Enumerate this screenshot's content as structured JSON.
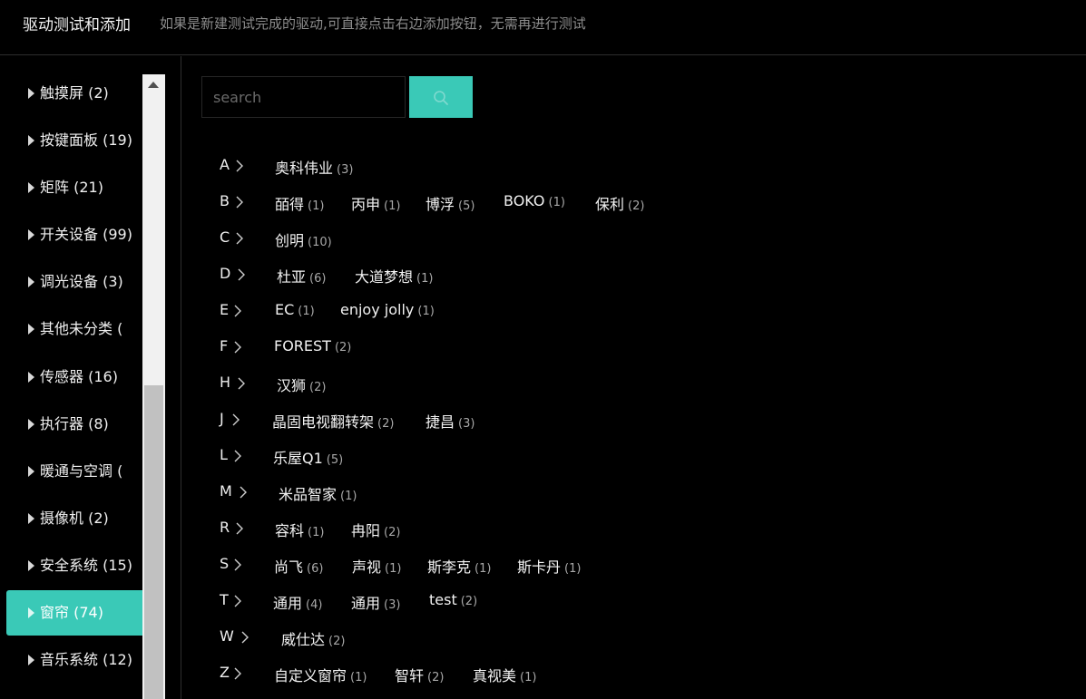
{
  "header": {
    "title": "驱动测试和添加",
    "hint": "如果是新建测试完成的驱动,可直接点击右边添加按钮，无需再进行测试"
  },
  "sidebar": {
    "items": [
      {
        "label": "触摸屏 (2)",
        "active": false
      },
      {
        "label": "按键面板 (19)",
        "active": false
      },
      {
        "label": "矩阵 (21)",
        "active": false
      },
      {
        "label": "开关设备 (99)",
        "active": false
      },
      {
        "label": "调光设备 (3)",
        "active": false
      },
      {
        "label": "其他未分类 (",
        "active": false
      },
      {
        "label": "传感器 (16)",
        "active": false
      },
      {
        "label": "执行器 (8)",
        "active": false
      },
      {
        "label": "暖通与空调 (",
        "active": false
      },
      {
        "label": "摄像机 (2)",
        "active": false
      },
      {
        "label": "安全系统 (15)",
        "active": false
      },
      {
        "label": "窗帘 (74)",
        "active": true
      },
      {
        "label": "音乐系统 (12)",
        "active": false
      }
    ]
  },
  "search": {
    "placeholder": "search",
    "value": "",
    "button_icon": "search-icon"
  },
  "colors": {
    "accent": "#3ac9b7",
    "background": "#000000",
    "text": "#f0f0f0",
    "muted": "#a8a8a8"
  },
  "brand_groups": [
    {
      "letter": "A",
      "brands": [
        {
          "name": "奥科伟业",
          "count": "(3)"
        }
      ]
    },
    {
      "letter": "B",
      "brands": [
        {
          "name": "皕得",
          "count": "(1)"
        },
        {
          "name": "丙申",
          "count": "(1)"
        },
        {
          "name": "博浮",
          "count": "(5)"
        },
        {
          "name": "BOKO",
          "count": "(1)"
        },
        {
          "name": "保利",
          "count": "(2)"
        }
      ]
    },
    {
      "letter": "C",
      "brands": [
        {
          "name": "创明",
          "count": "(10)"
        }
      ]
    },
    {
      "letter": "D",
      "brands": [
        {
          "name": "杜亚",
          "count": "(6)"
        },
        {
          "name": "大道梦想",
          "count": "(1)"
        }
      ]
    },
    {
      "letter": "E",
      "brands": [
        {
          "name": "EC",
          "count": "(1)"
        },
        {
          "name": "enjoy jolly",
          "count": "(1)"
        }
      ]
    },
    {
      "letter": "F",
      "brands": [
        {
          "name": "FOREST",
          "count": "(2)"
        }
      ]
    },
    {
      "letter": "H",
      "brands": [
        {
          "name": "汉狮",
          "count": "(2)"
        }
      ]
    },
    {
      "letter": "J",
      "brands": [
        {
          "name": "晶固电视翻转架",
          "count": "(2)"
        },
        {
          "name": "捷昌",
          "count": "(3)"
        }
      ]
    },
    {
      "letter": "L",
      "brands": [
        {
          "name": "乐屋Q1",
          "count": "(5)"
        }
      ]
    },
    {
      "letter": "M",
      "brands": [
        {
          "name": "米品智家",
          "count": "(1)"
        }
      ]
    },
    {
      "letter": "R",
      "brands": [
        {
          "name": "容科",
          "count": "(1)"
        },
        {
          "name": "冉阳",
          "count": "(2)"
        }
      ]
    },
    {
      "letter": "S",
      "brands": [
        {
          "name": "尚飞",
          "count": "(6)"
        },
        {
          "name": "声视",
          "count": "(1)"
        },
        {
          "name": "斯李克",
          "count": "(1)"
        },
        {
          "name": "斯卡丹",
          "count": "(1)"
        }
      ]
    },
    {
      "letter": "T",
      "brands": [
        {
          "name": "通用",
          "count": "(4)"
        },
        {
          "name": "通用",
          "count": "(3)"
        },
        {
          "name": "test",
          "count": "(2)"
        }
      ]
    },
    {
      "letter": "W",
      "brands": [
        {
          "name": "威仕达",
          "count": "(2)"
        }
      ]
    },
    {
      "letter": "Z",
      "brands": [
        {
          "name": "自定义窗帘",
          "count": "(1)"
        },
        {
          "name": "智轩",
          "count": "(2)"
        },
        {
          "name": "真视美",
          "count": "(1)"
        }
      ]
    }
  ]
}
